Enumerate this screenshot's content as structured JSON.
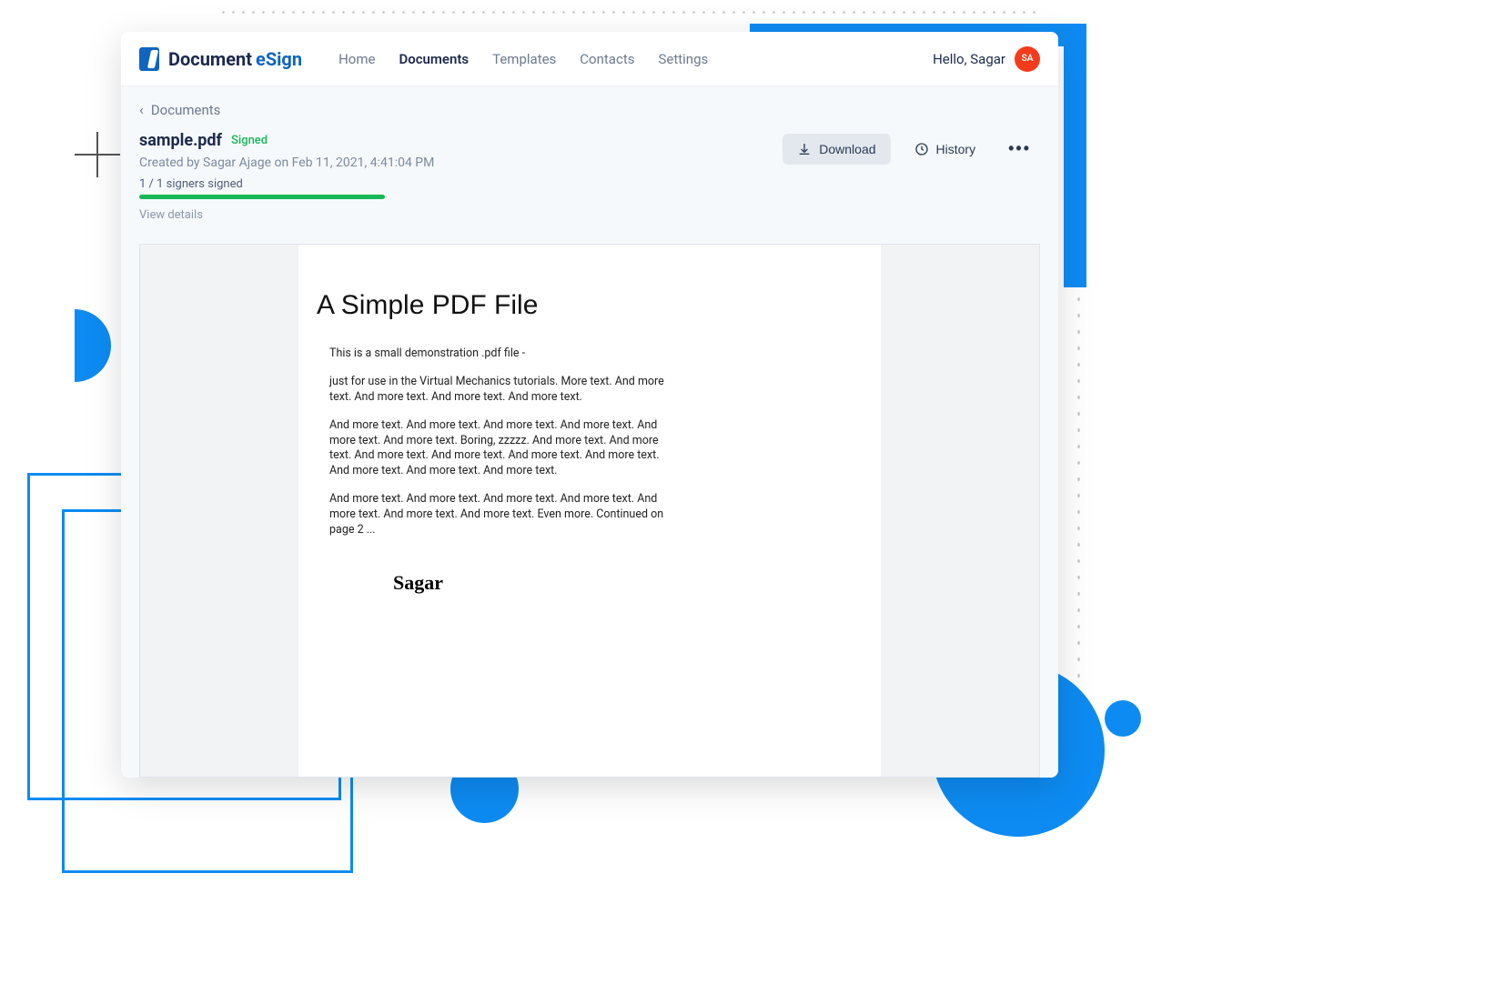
{
  "brand": {
    "part1": "Document",
    "part2": "eSign"
  },
  "nav": {
    "home": "Home",
    "documents": "Documents",
    "templates": "Templates",
    "contacts": "Contacts",
    "settings": "Settings"
  },
  "user": {
    "greeting": "Hello, Sagar",
    "initials": "SA"
  },
  "breadcrumb": {
    "label": "Documents"
  },
  "document": {
    "title": "sample.pdf",
    "status": "Signed",
    "created": "Created by Sagar Ajage on Feb 11, 2021, 4:41:04 PM",
    "signers": "1 / 1 signers signed",
    "view_details": "View details"
  },
  "actions": {
    "download": "Download",
    "history": "History"
  },
  "pdf": {
    "heading": "A Simple PDF File",
    "p1": "This is a small demonstration .pdf file -",
    "p2": "just for use in the Virtual Mechanics tutorials. More text. And more text. And more text. And more text. And more text.",
    "p3": "And more text. And more text. And more text. And more text. And more text. And more text. Boring, zzzzz. And more text. And more text. And more text. And more text. And more text. And more text. And more text. And more text. And more text.",
    "p4": "And more text. And more text. And more text. And more text. And more text. And more text. And more text. Even more. Continued on page 2 ...",
    "signature": "Sagar"
  }
}
